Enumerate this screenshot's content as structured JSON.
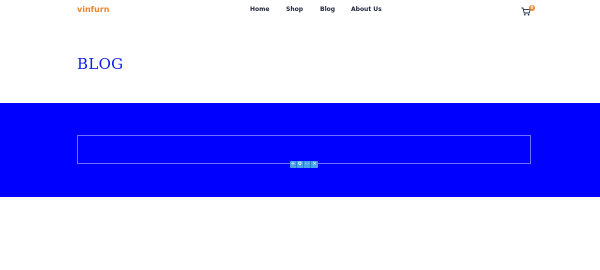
{
  "header": {
    "logo": "vinfurn",
    "nav": [
      {
        "label": "Home"
      },
      {
        "label": "Shop"
      },
      {
        "label": "Blog"
      },
      {
        "label": "About Us"
      }
    ],
    "cart": {
      "icon": "cart-icon",
      "badge": "0"
    }
  },
  "page": {
    "title": "BLOG"
  },
  "band": {
    "background": "#0000ff",
    "toolbar": [
      {
        "icon": "add-icon",
        "glyph": "+"
      },
      {
        "icon": "edit-icon",
        "glyph": "⚙"
      },
      {
        "icon": "drag-icon",
        "glyph": "⋯"
      },
      {
        "icon": "delete-icon",
        "glyph": "×"
      }
    ]
  },
  "colors": {
    "brand": "#e8852a",
    "title": "#1020e8",
    "nav_text": "#23283f",
    "toolbar": "#4aa3e8"
  }
}
